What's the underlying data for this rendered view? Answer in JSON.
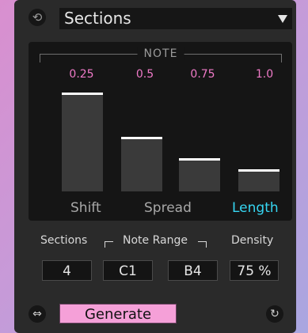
{
  "header": {
    "reset_icon": "reset-icon",
    "selector_value": "Sections"
  },
  "panel": {
    "title": "NOTE",
    "columns": [
      {
        "label": "Shift",
        "value_text": "0.25",
        "level": 0.25
      },
      {
        "label": "Spread",
        "value_text": "0.5",
        "level": 0.5
      },
      {
        "label": "Length",
        "value_text": "0.75",
        "level": 0.75
      },
      {
        "label": "",
        "value_text": "1.0",
        "level": 1.0
      }
    ]
  },
  "controls": {
    "sections_label": "Sections",
    "note_range_label": "Note Range",
    "density_label": "Density",
    "sections_value": "4",
    "range_low": "C1",
    "range_high": "B4",
    "density_value": "75 %"
  },
  "footer": {
    "generate_label": "Generate",
    "left_icon": "loop-icon",
    "right_icon": "refresh-icon"
  }
}
